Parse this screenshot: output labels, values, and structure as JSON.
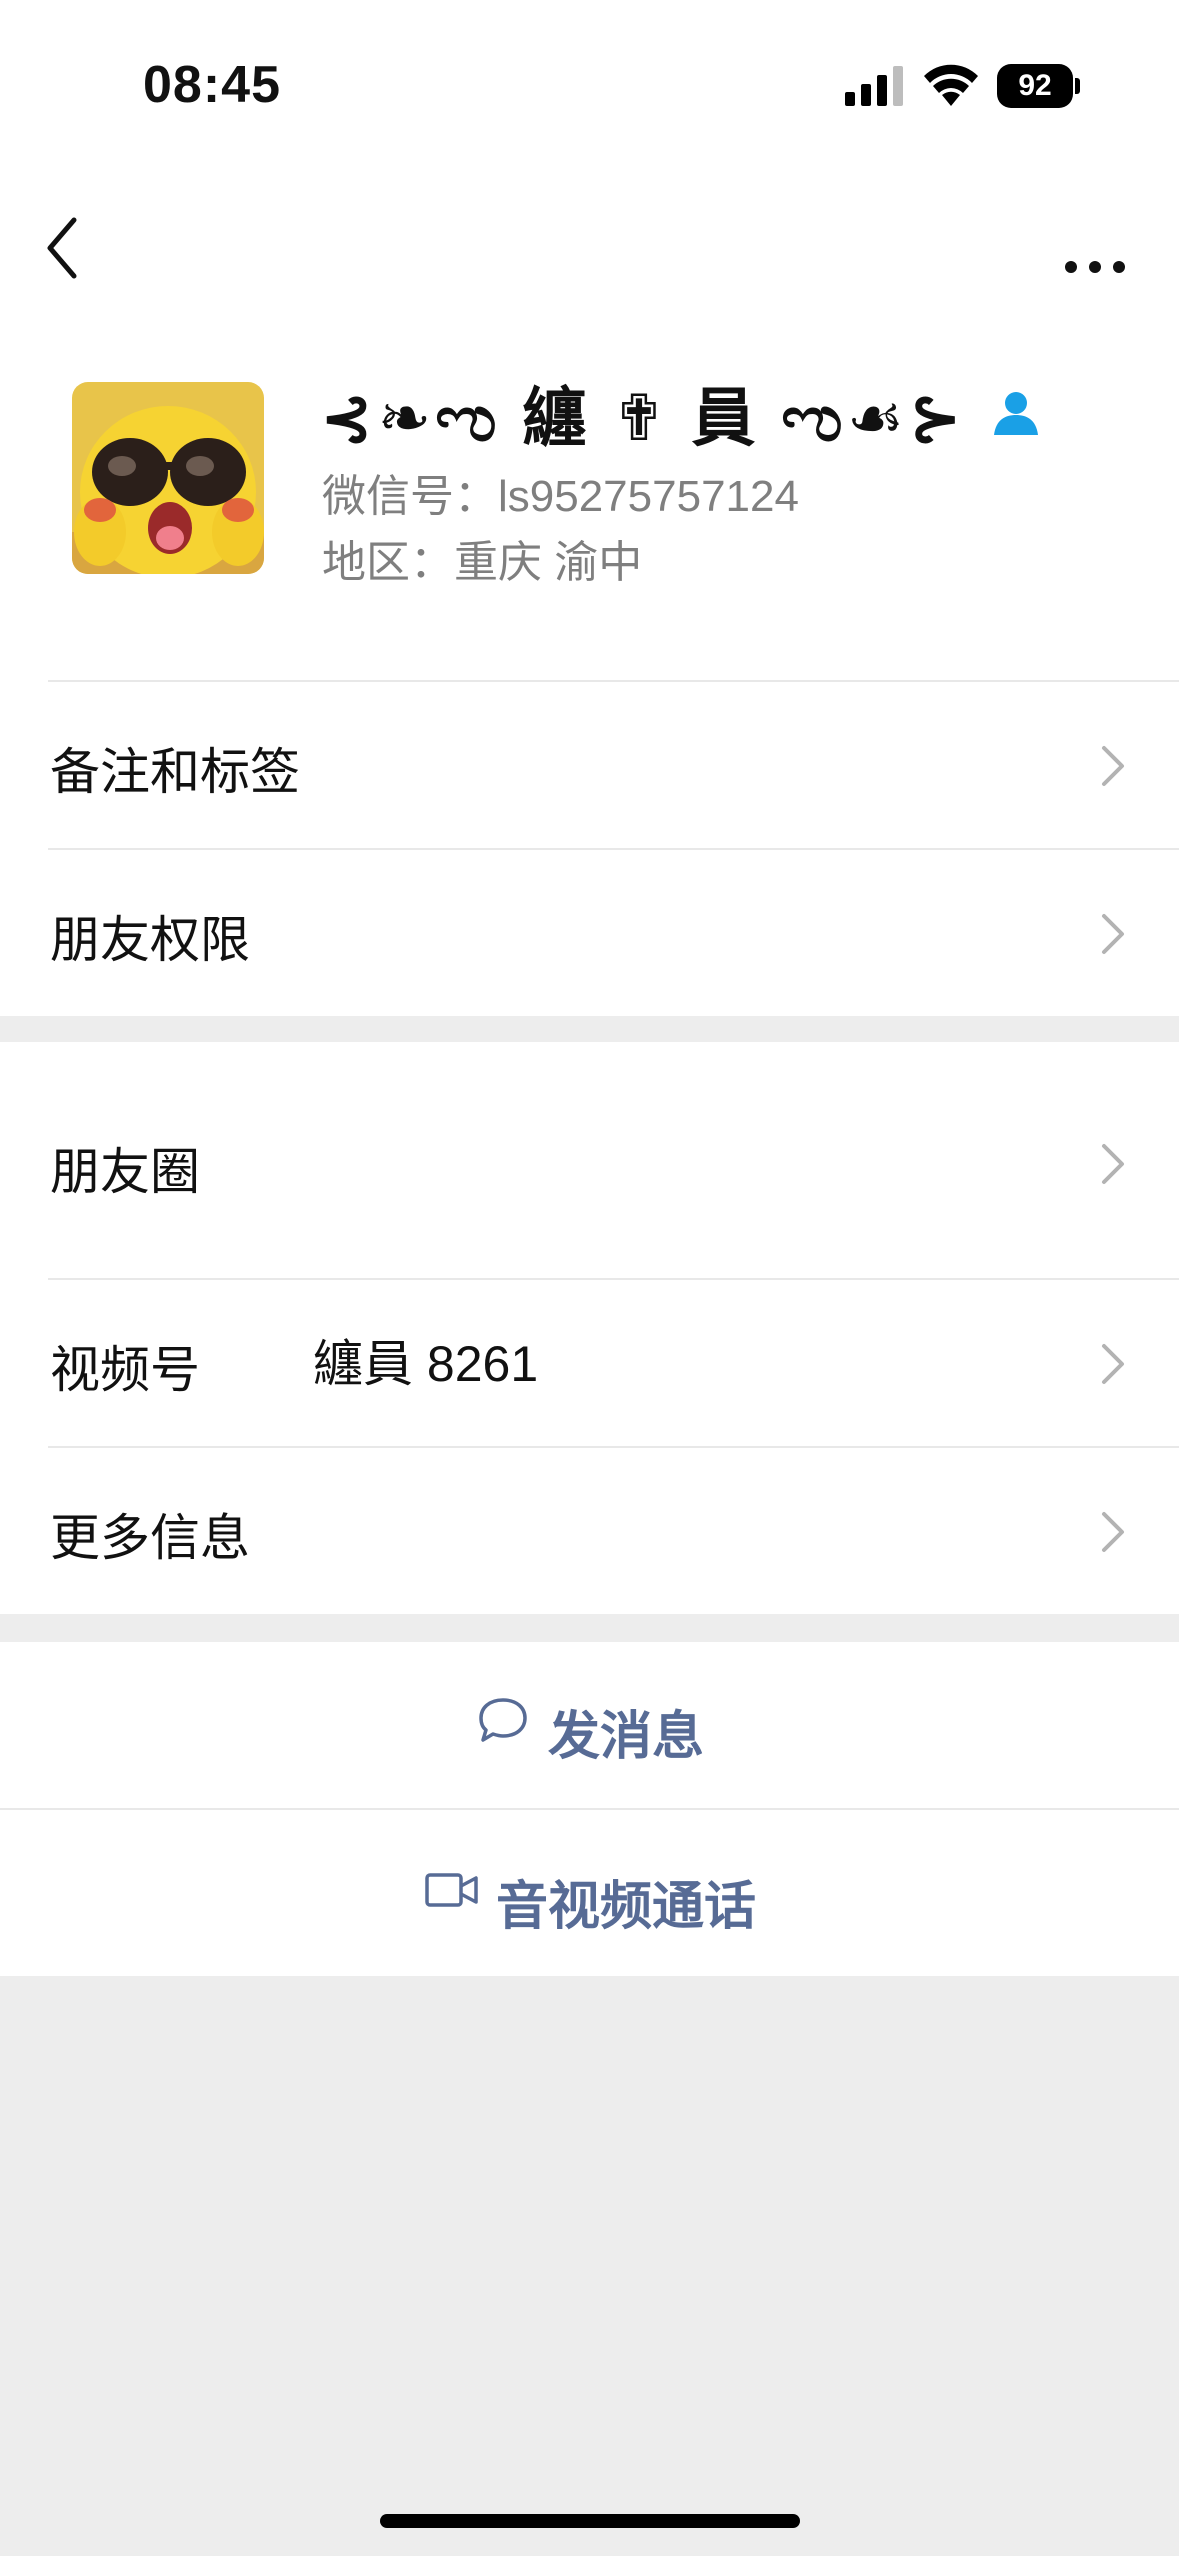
{
  "status_bar": {
    "time": "08:45",
    "battery": "92"
  },
  "profile": {
    "nickname": "⊰❧ಌ 纏 ✟ 員 ಌ☙⊱",
    "wechat_id": "微信号：ls95275757124",
    "region": "地区：重庆 渝中"
  },
  "rows": {
    "remark": "备注和标签",
    "permissions": "朋友权限",
    "moments": "朋友圈",
    "channels": "视频号",
    "channels_value": "纏員 8261",
    "more_info": "更多信息"
  },
  "actions": {
    "message": "发消息",
    "call": "音视频通话"
  },
  "colors": {
    "link": "#576b95",
    "contact_icon": "#1aa0e6",
    "background": "#ededed"
  }
}
